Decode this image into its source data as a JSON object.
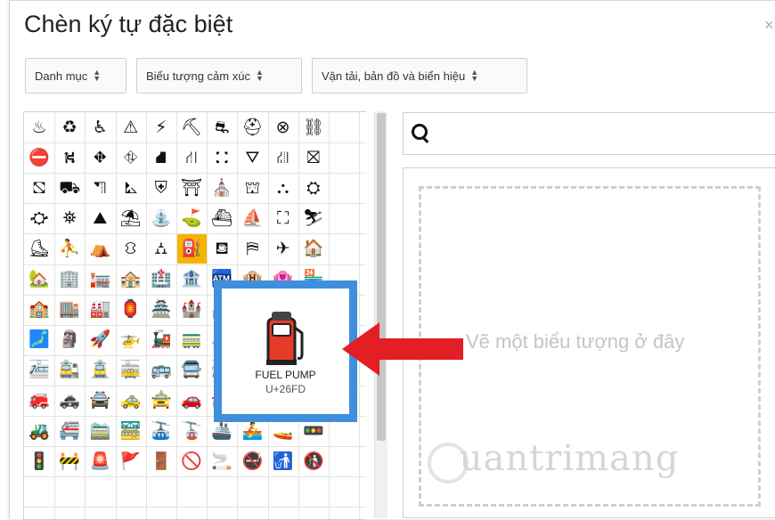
{
  "dialog": {
    "title": "Chèn ký tự đặc biệt",
    "close": "×"
  },
  "dropdowns": {
    "category": "Danh mục",
    "type": "Biểu tượng cảm xúc",
    "subtype": "Vận tải, bản đồ và biển hiệu"
  },
  "search": {
    "value": "",
    "placeholder": ""
  },
  "drawing": {
    "placeholder": "Vẽ một biểu tượng ở đây"
  },
  "popup": {
    "name": "FUEL PUMP",
    "code": "U+26FD"
  },
  "watermark": "uantrimang",
  "colors": {
    "selected_cell": "#f5b400",
    "popup_border": "#3f8fdc",
    "arrow": "#e31e24"
  },
  "grid": [
    [
      "♨",
      "♻",
      "♿",
      "⚠",
      "⚡",
      "⛏",
      "⛐",
      "⛑",
      "⊗",
      "⛓"
    ],
    [
      "⛔",
      "⛕",
      "⛖",
      "⛗",
      "⛘",
      "⛙",
      "⛚",
      "⛛",
      "⛜",
      "⛝"
    ],
    [
      "⛞",
      "⛟",
      "⛠",
      "⛡",
      "⛨",
      "⛩",
      "⛪",
      "⛫",
      "⛬",
      "⛭"
    ],
    [
      "⛮",
      "⛯",
      "⛰",
      "⛱",
      "⛲",
      "⛳",
      "⛴",
      "⛵",
      "⛶",
      "⛷"
    ],
    [
      "⛸",
      "⛹",
      "⛺",
      "⛻",
      "⛼",
      "⛽",
      "⛾",
      "⛿",
      "✈",
      "🏠"
    ],
    [
      "🏡",
      "🏢",
      "🏣",
      "🏤",
      "🏥",
      "🏦",
      "🏧",
      "🏨",
      "🏩",
      "🏪"
    ],
    [
      "🏫",
      "🏬",
      "🏭",
      "🏮",
      "🏯",
      "🏰",
      "💒",
      "🗻",
      "🗼",
      "🗽"
    ],
    [
      "🗾",
      "🗿",
      "🚀",
      "🚁",
      "🚂",
      "🚃",
      "🚄",
      "🚅",
      "🚆",
      "🚇"
    ],
    [
      "🚈",
      "🚉",
      "🚊",
      "🚋",
      "🚌",
      "🚍",
      "🚎",
      "🚏",
      "🚐",
      "🚑"
    ],
    [
      "🚒",
      "🚓",
      "🚔",
      "🚕",
      "🚖",
      "🚗",
      "🚘",
      "🚙",
      "🚚",
      "🚛"
    ],
    [
      "🚜",
      "🚝",
      "🚞",
      "🚟",
      "🚠",
      "🚡",
      "🚢",
      "🚣",
      "🚤",
      "🚥"
    ],
    [
      "🚦",
      "🚧",
      "🚨",
      "🚩",
      "🚪",
      "🚫",
      "🚬",
      "🚭",
      "🚮",
      "🚯"
    ]
  ]
}
